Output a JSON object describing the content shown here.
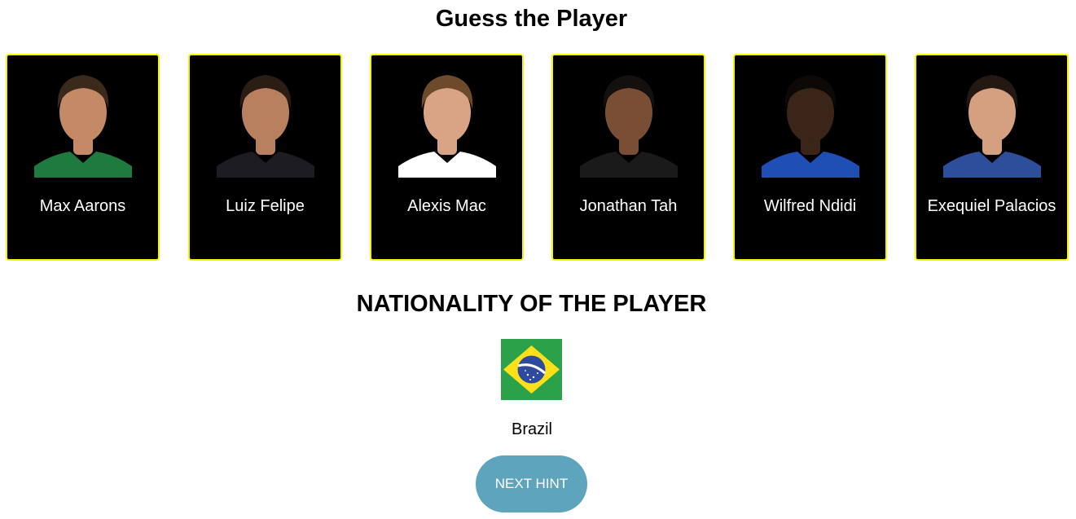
{
  "page_title": "Guess the Player",
  "players": [
    {
      "name": "Max Aarons",
      "shirt": "#1e7a3e",
      "skin": "#c48a66",
      "hair": "#3b2a1c"
    },
    {
      "name": "Luiz Felipe",
      "shirt": "#1c1c22",
      "skin": "#b98060",
      "hair": "#2a1d14"
    },
    {
      "name": "Alexis Mac",
      "shirt": "#ffffff",
      "skin": "#d8a485",
      "hair": "#6d4a2c"
    },
    {
      "name": "Jonathan Tah",
      "shirt": "#1a1a1a",
      "skin": "#7a4e35",
      "hair": "#151010"
    },
    {
      "name": "Wilfred Ndidi",
      "shirt": "#1f4fb4",
      "skin": "#3b2418",
      "hair": "#0d0907"
    },
    {
      "name": "Exequiel Palacios",
      "shirt": "#2d4e9a",
      "skin": "#d4a080",
      "hair": "#231812"
    }
  ],
  "hint": {
    "title": "NATIONALITY OF THE PLAYER",
    "country": "Brazil",
    "flag_colors": {
      "green": "#2ba24a",
      "yellow": "#fde018",
      "blue": "#2e4a9e"
    }
  },
  "next_hint_label": "NEXT HINT",
  "colors": {
    "card_background": "#000000",
    "card_border": "#f5f500",
    "button": "#5fa4bd"
  }
}
